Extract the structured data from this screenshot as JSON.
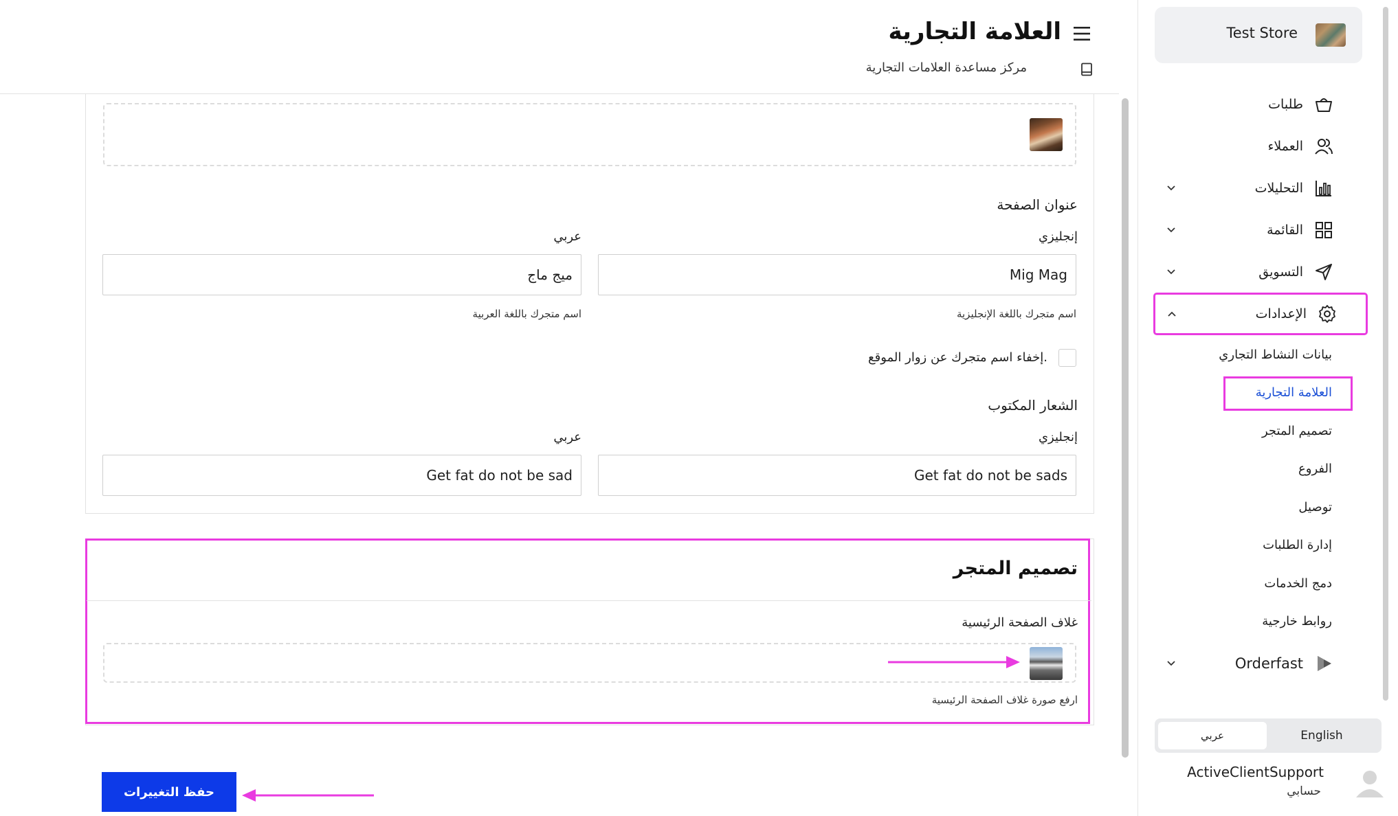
{
  "header": {
    "title": "العلامة التجارية",
    "help_link": "مركز مساعدة العلامات التجارية"
  },
  "sidebar": {
    "store_name": "Test Store",
    "nav": [
      {
        "label": "طلبات",
        "icon": "basket-icon"
      },
      {
        "label": "العملاء",
        "icon": "users-icon"
      },
      {
        "label": "التحليلات",
        "icon": "bar-chart-icon"
      },
      {
        "label": "القائمة",
        "icon": "grid-icon"
      },
      {
        "label": "التسويق",
        "icon": "send-icon"
      },
      {
        "label": "الإعدادات",
        "icon": "gear-icon"
      }
    ],
    "settings_sub": [
      "بيانات النشاط التجاري",
      "العلامة التجارية",
      "تصميم المتجر",
      "الفروع",
      "توصيل",
      "إدارة الطلبات",
      "دمج الخدمات",
      "روابط خارجية"
    ],
    "orderfast": {
      "label": "Orderfast",
      "icon": "play-icon"
    },
    "language": {
      "english": "English",
      "arabic": "عربي"
    },
    "user": {
      "name": "ActiveClientSupport",
      "account": "حسابي"
    }
  },
  "brand_form": {
    "page_title_section": "عنوان الصفحة",
    "english_label": "إنجليزي",
    "arabic_label": "عربي",
    "name_en_value": "Mig Mag",
    "name_ar_value": "ميج ماج",
    "name_en_helper": "اسم متجرك باللغة الإنجليزية",
    "name_ar_helper": "اسم متجرك باللغة العربية",
    "hide_name_label": "إخفاء اسم متجرك عن زوار الموقع.",
    "slogan_section": "الشعار المكتوب",
    "slogan_en_value": "Get fat do not be sads",
    "slogan_ar_value": "Get fat do not be sad"
  },
  "store_design": {
    "title": "تصميم المتجر",
    "cover_label": "غلاف الصفحة الرئيسية",
    "cover_helper": "ارفع صورة غلاف الصفحة الرئيسية"
  },
  "actions": {
    "save_label": "حفظ التغييرات"
  },
  "colors": {
    "accent": "#0d3ae8",
    "highlight": "#e93be0",
    "active_link": "#1a4fd6"
  }
}
